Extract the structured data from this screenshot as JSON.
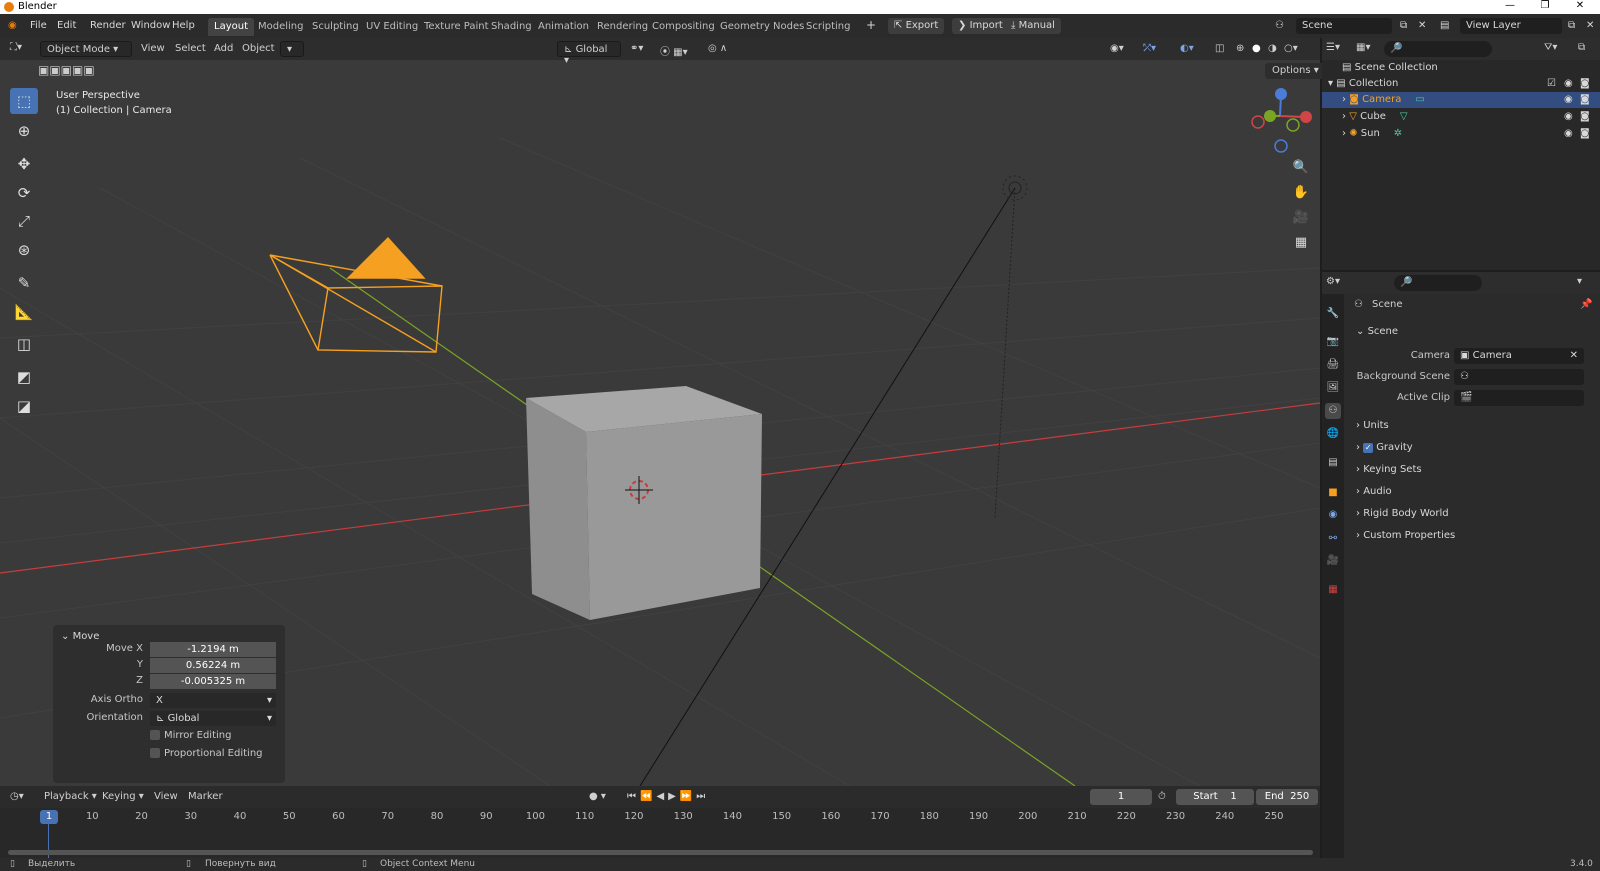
{
  "window": {
    "title": "Blender",
    "version": "3.4.0"
  },
  "menus": {
    "file": "File",
    "edit": "Edit",
    "render": "Render",
    "window": "Window",
    "help": "Help"
  },
  "workspaces": [
    "Layout",
    "Modeling",
    "Sculpting",
    "UV Editing",
    "Texture Paint",
    "Shading",
    "Animation",
    "Rendering",
    "Compositing",
    "Geometry Nodes",
    "Scripting"
  ],
  "topbar": {
    "export": "Export",
    "import": "Import",
    "manual": "Manual",
    "scene": "Scene",
    "view_layer": "View Layer"
  },
  "viewport": {
    "mode": "Object Mode",
    "view": "View",
    "select": "Select",
    "add": "Add",
    "object": "Object",
    "orientation": "Global",
    "options": "Options",
    "info_line1": "User Perspective",
    "info_line2": "(1) Collection | Camera"
  },
  "move_panel": {
    "title": "Move",
    "move_x_label": "Move X",
    "move_x": "-1.2194 m",
    "y_label": "Y",
    "y": "0.56224 m",
    "z_label": "Z",
    "z": "-0.005325 m",
    "axis_ortho_label": "Axis Ortho",
    "axis_ortho": "X",
    "orientation_label": "Orientation",
    "orientation": "Global",
    "mirror": "Mirror Editing",
    "proportional": "Proportional Editing"
  },
  "timeline": {
    "playback": "Playback",
    "keying": "Keying",
    "view": "View",
    "marker": "Marker",
    "current_frame": "1",
    "start_label": "Start",
    "start": "1",
    "end_label": "End",
    "end": "250",
    "ticks": [
      "10",
      "20",
      "30",
      "40",
      "50",
      "60",
      "70",
      "80",
      "90",
      "100",
      "110",
      "120",
      "130",
      "140",
      "150",
      "160",
      "170",
      "180",
      "190",
      "200",
      "210",
      "220",
      "230",
      "240",
      "250"
    ]
  },
  "statusbar": {
    "select": "Выделить",
    "rotate": "Повернуть вид",
    "context": "Object Context Menu"
  },
  "outliner": {
    "scene_collection": "Scene Collection",
    "collection": "Collection",
    "items": [
      {
        "name": "Camera",
        "selected": true
      },
      {
        "name": "Cube",
        "selected": false
      },
      {
        "name": "Sun",
        "selected": false
      }
    ]
  },
  "properties": {
    "header": "Scene",
    "section": "Scene",
    "camera_label": "Camera",
    "camera_value": "Camera",
    "bg_label": "Background Scene",
    "clip_label": "Active Clip",
    "sections": [
      "Units",
      "Gravity",
      "Keying Sets",
      "Audio",
      "Rigid Body World",
      "Custom Properties"
    ]
  },
  "colors": {
    "accent": "#4772b3",
    "selected_obj": "#f5a020",
    "x_axis": "#c83c3c",
    "y_axis": "#7ba424"
  }
}
